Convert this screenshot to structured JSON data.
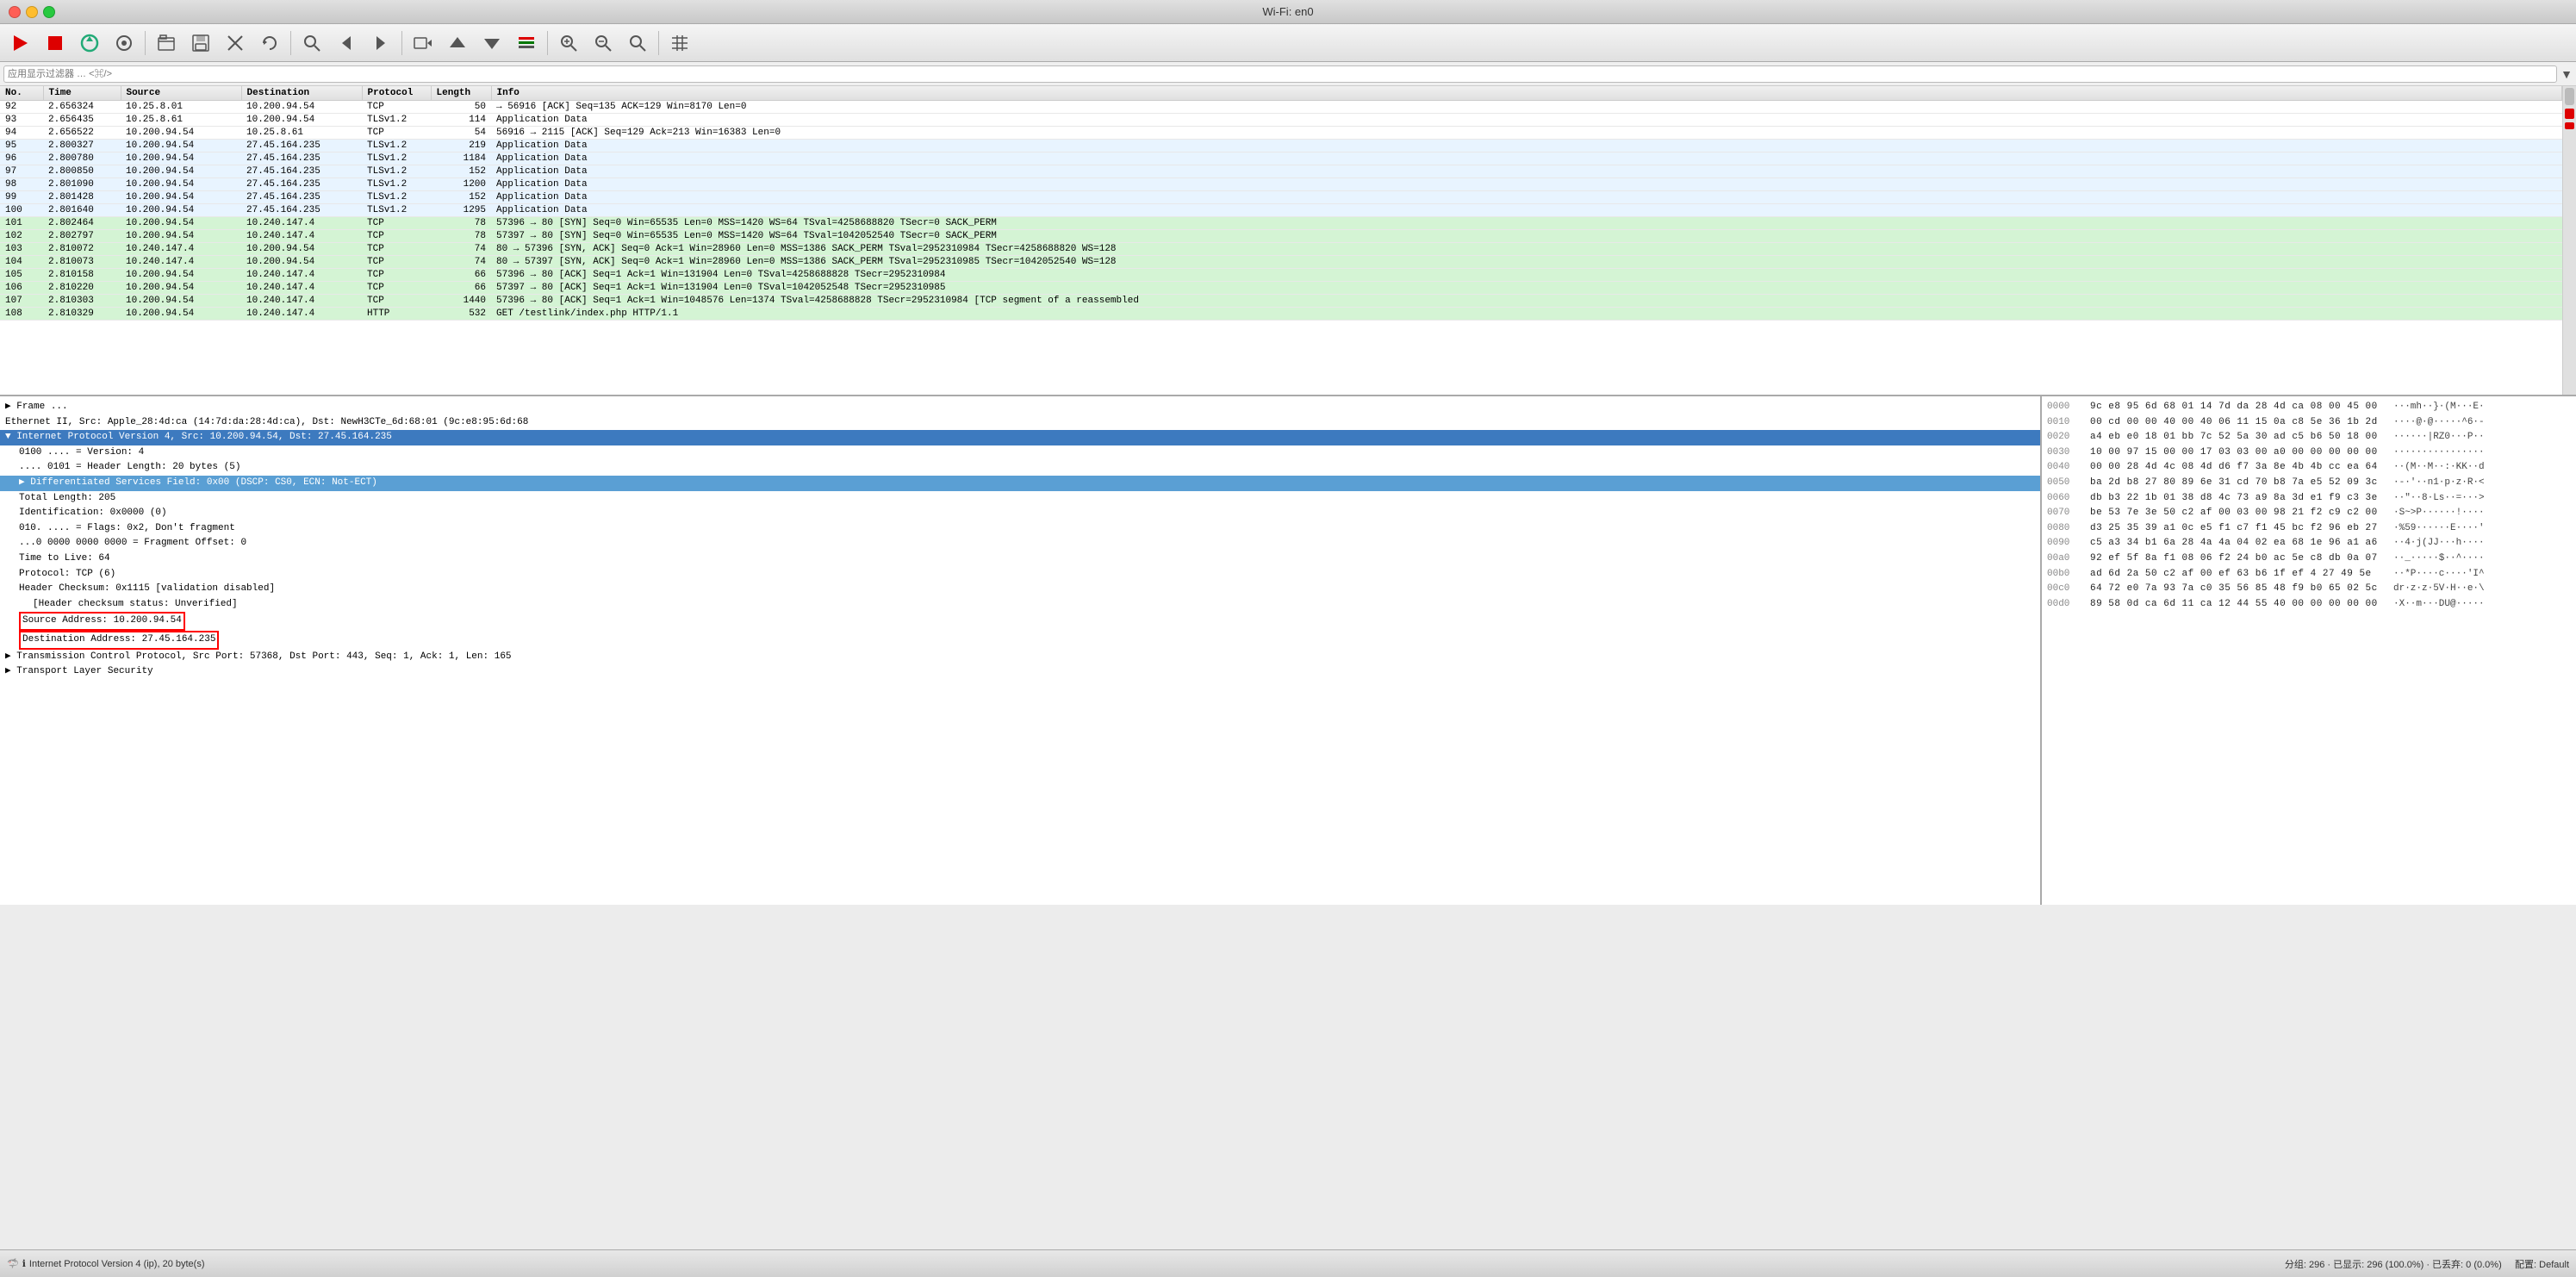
{
  "window": {
    "title": "Wi-Fi: en0"
  },
  "toolbar": {
    "buttons": [
      "🔴",
      "🦈",
      "⚙",
      "📁",
      "💾",
      "✖",
      "🔄",
      "🔍",
      "◀",
      "▶",
      "⬆↓",
      "⬆",
      "⬇",
      "🔲",
      "➕",
      "➖",
      "🔎",
      "🔍",
      "📊"
    ]
  },
  "filter": {
    "placeholder": "应用显示过滤器 … <⌘/>",
    "value": ""
  },
  "columns": {
    "no": "No.",
    "time": "Time",
    "source": "Source",
    "destination": "Destination",
    "protocol": "Protocol",
    "length": "Length",
    "info": "Info"
  },
  "packets": [
    {
      "no": "92",
      "time": "2.656324",
      "src": "10.25.8.01",
      "dst": "10.200.94.54",
      "proto": "TCP",
      "len": "50",
      "info": "→ 56916 [ACK] Seq=135 ACK=129 Win=8170 Len=0",
      "style": "normal"
    },
    {
      "no": "93",
      "time": "2.656435",
      "src": "10.25.8.61",
      "dst": "10.200.94.54",
      "proto": "TLSv1.2",
      "len": "114",
      "info": "Application Data",
      "style": "normal"
    },
    {
      "no": "94",
      "time": "2.656522",
      "src": "10.200.94.54",
      "dst": "10.25.8.61",
      "proto": "TCP",
      "len": "54",
      "info": "56916 → 2115 [ACK] Seq=129 Ack=213 Win=16383 Len=0",
      "style": "normal"
    },
    {
      "no": "95",
      "time": "2.800327",
      "src": "10.200.94.54",
      "dst": "27.45.164.235",
      "proto": "TLSv1.2",
      "len": "219",
      "info": "Application Data",
      "style": "highlight"
    },
    {
      "no": "96",
      "time": "2.800780",
      "src": "10.200.94.54",
      "dst": "27.45.164.235",
      "proto": "TLSv1.2",
      "len": "1184",
      "info": "Application Data",
      "style": "highlight"
    },
    {
      "no": "97",
      "time": "2.800850",
      "src": "10.200.94.54",
      "dst": "27.45.164.235",
      "proto": "TLSv1.2",
      "len": "152",
      "info": "Application Data",
      "style": "highlight"
    },
    {
      "no": "98",
      "time": "2.801090",
      "src": "10.200.94.54",
      "dst": "27.45.164.235",
      "proto": "TLSv1.2",
      "len": "1200",
      "info": "Application Data",
      "style": "highlight"
    },
    {
      "no": "99",
      "time": "2.801428",
      "src": "10.200.94.54",
      "dst": "27.45.164.235",
      "proto": "TLSv1.2",
      "len": "152",
      "info": "Application Data",
      "style": "highlight"
    },
    {
      "no": "100",
      "time": "2.801640",
      "src": "10.200.94.54",
      "dst": "27.45.164.235",
      "proto": "TLSv1.2",
      "len": "1295",
      "info": "Application Data",
      "style": "highlight"
    },
    {
      "no": "101",
      "time": "2.802464",
      "src": "10.200.94.54",
      "dst": "10.240.147.4",
      "proto": "TCP",
      "len": "78",
      "info": "57396 → 80 [SYN] Seq=0 Win=65535 Len=0 MSS=1420 WS=64 TSval=4258688820 TSecr=0 SACK_PERM",
      "style": "green"
    },
    {
      "no": "102",
      "time": "2.802797",
      "src": "10.200.94.54",
      "dst": "10.240.147.4",
      "proto": "TCP",
      "len": "78",
      "info": "57397 → 80 [SYN] Seq=0 Win=65535 Len=0 MSS=1420 WS=64 TSval=1042052540 TSecr=0 SACK_PERM",
      "style": "green"
    },
    {
      "no": "103",
      "time": "2.810072",
      "src": "10.240.147.4",
      "dst": "10.200.94.54",
      "proto": "TCP",
      "len": "74",
      "info": "80 → 57396 [SYN, ACK] Seq=0 Ack=1 Win=28960 Len=0 MSS=1386 SACK_PERM TSval=2952310984 TSecr=4258688820 WS=128",
      "style": "green"
    },
    {
      "no": "104",
      "time": "2.810073",
      "src": "10.240.147.4",
      "dst": "10.200.94.54",
      "proto": "TCP",
      "len": "74",
      "info": "80 → 57397 [SYN, ACK] Seq=0 Ack=1 Win=28960 Len=0 MSS=1386 SACK_PERM TSval=2952310985 TSecr=1042052540 WS=128",
      "style": "green"
    },
    {
      "no": "105",
      "time": "2.810158",
      "src": "10.200.94.54",
      "dst": "10.240.147.4",
      "proto": "TCP",
      "len": "66",
      "info": "57396 → 80 [ACK] Seq=1 Ack=1 Win=131904 Len=0 TSval=4258688828 TSecr=2952310984",
      "style": "green"
    },
    {
      "no": "106",
      "time": "2.810220",
      "src": "10.200.94.54",
      "dst": "10.240.147.4",
      "proto": "TCP",
      "len": "66",
      "info": "57397 → 80 [ACK] Seq=1 Ack=1 Win=131904 Len=0 TSval=1042052548 TSecr=2952310985",
      "style": "green"
    },
    {
      "no": "107",
      "time": "2.810303",
      "src": "10.200.94.54",
      "dst": "10.240.147.4",
      "proto": "TCP",
      "len": "1440",
      "info": "57396 → 80 [ACK] Seq=1 Ack=1 Win=1048576 Len=1374 TSval=4258688828 TSecr=2952310984 [TCP segment of a reassembled",
      "style": "green"
    },
    {
      "no": "108",
      "time": "2.810329",
      "src": "10.200.94.54",
      "dst": "10.240.147.4",
      "proto": "HTTP",
      "len": "532",
      "info": "GET /testlink/index.php HTTP/1.1",
      "style": "green"
    }
  ],
  "detail": {
    "frame_line": "▶ Frame ...",
    "ethernet_line": "Ethernet II, Src: Apple_28:4d:ca (14:7d:da:28:4d:ca), Dst: NewH3CTe_6d:68:01 (9c:e8:95:6d:68",
    "ipv4_line": "▼ Internet Protocol Version 4, Src: 10.200.94.54, Dst: 27.45.164.235",
    "version_line": "0100 .... = Version: 4",
    "header_len_line": ".... 0101 = Header Length: 20 bytes (5)",
    "dsf_line": "▶ Differentiated Services Field: 0x00 (DSCP: CS0, ECN: Not-ECT)",
    "total_len_line": "Total Length: 205",
    "ident_line": "Identification: 0x0000 (0)",
    "flags_line": "010. .... = Flags: 0x2, Don't fragment",
    "frag_line": "...0 0000 0000 0000 = Fragment Offset: 0",
    "ttl_line": "Time to Live: 64",
    "proto_line": "Protocol: TCP (6)",
    "checksum_line": "Header Checksum: 0x1115 [validation disabled]",
    "checksum_status_line": "[Header checksum status: Unverified]",
    "src_addr_line": "Source Address: 10.200.94.54",
    "dst_addr_line": "Destination Address: 27.45.164.235",
    "tcp_line": "▶ Transmission Control Protocol, Src Port: 57368, Dst Port: 443, Seq: 1, Ack: 1, Len: 165",
    "tls_line": "▶ Transport Layer Security"
  },
  "hex": {
    "lines": [
      {
        "offset": "0000",
        "bytes": "9c e8 95 6d 68 01 14 7d  da 28 4d ca 08 00 45 00",
        "ascii": "···mh··}·(M···E·"
      },
      {
        "offset": "0010",
        "bytes": "00 cd 00 00 40 00 40 06  11 15 0a c8 5e 36 1b 2d",
        "ascii": "····@·@·····^6·-"
      },
      {
        "offset": "0020",
        "bytes": "a4 eb e0 18 01 bb 7c 52  5a 30 ad c5 b6 50 18 00",
        "ascii": "······|RZ0···P··"
      },
      {
        "offset": "0030",
        "bytes": "10 00 97 15 00 00 17 03  03 00 a0 00 00 00 00 00",
        "ascii": "················"
      },
      {
        "offset": "0040",
        "bytes": "00 00 28 4d 4c 08 4d d6  f7 3a 8e 4b 4b cc ea 64",
        "ascii": "··(M··M··:·KK··d"
      },
      {
        "offset": "0050",
        "bytes": "ba 2d b8 27 80 89 6e 31  cd 70 b8 7a e5 52 09 3c",
        "ascii": "·-·'··n1·p·z·R·<"
      },
      {
        "offset": "0060",
        "bytes": "db b3 22 1b 01 38 d8 4c  73 a9 8a 3d e1 f9 c3 3e",
        "ascii": "··\"··8·Ls··=···>"
      },
      {
        "offset": "0070",
        "bytes": "be 53 7e 3e 50 c2 af 00  03 00 98 21 f2 c9 c2 00",
        "ascii": "·S~>P······!····"
      },
      {
        "offset": "0080",
        "bytes": "d3 25 35 39 a1 0c e5 f1  c7 f1 45 bc f2 96 eb 27",
        "ascii": "·%59······E····'"
      },
      {
        "offset": "0090",
        "bytes": "c5 a3 34 b1 6a 28 4a 4a  04 02 ea 68 1e 96 a1 a6",
        "ascii": "··4·j(JJ···h····"
      },
      {
        "offset": "00a0",
        "bytes": "92 ef 5f 8a f1 08 06 f2  24 b0 ac 5e c8 db 0a 07",
        "ascii": "··_·····$··^····"
      },
      {
        "offset": "00b0",
        "bytes": "ad 6d 2a 50 c2 af 00 ef  63 b6 1f ef 4 27 49 5e",
        "ascii": "··*P····c····'I^"
      },
      {
        "offset": "00c0",
        "bytes": "64 72 e0 7a 93 7a c0 35  56 85 48 f9 b0 65 02 5c",
        "ascii": "dr·z·z·5V·H··e·\\"
      },
      {
        "offset": "00d0",
        "bytes": "89 58 0d ca 6d 11 ca 12  44 55 40 00 00 00 00 00",
        "ascii": "·X··m···DU@·····"
      }
    ]
  },
  "status": {
    "left_icon": "🦈",
    "info_icon": "ℹ",
    "label": "Internet Protocol Version 4 (ip), 20 byte(s)",
    "stats": "分组: 296 · 已显示: 296 (100.0%) · 已丢弃: 0 (0.0%)",
    "profile": "配置: Default"
  }
}
